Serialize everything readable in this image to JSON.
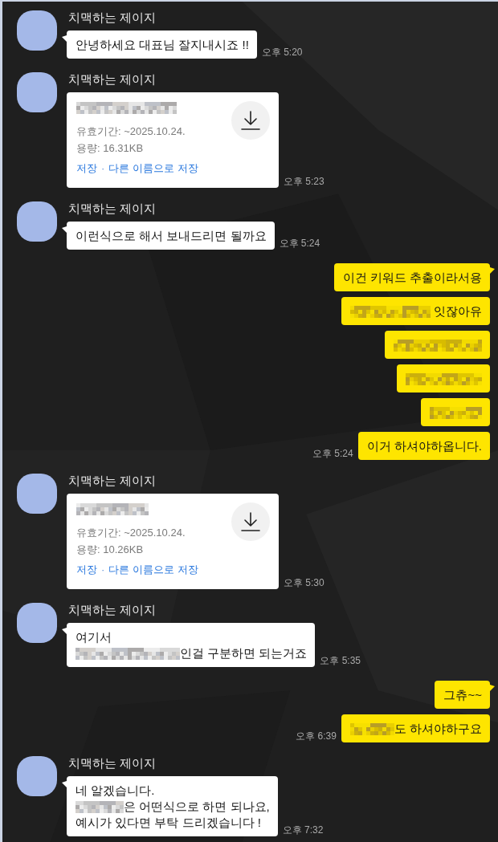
{
  "chat": [
    {
      "mine": false,
      "name": "치맥하는 제이지",
      "time": "오후 5:20",
      "messages": [
        {
          "kind": "text",
          "lines": [
            [
              {
                "kind": "text",
                "text": "안녕하세요 대표님 잘지내시죠 !!"
              }
            ]
          ]
        }
      ]
    },
    {
      "mine": false,
      "name": "치맥하는 제이지",
      "time": "오후 5:23",
      "messages": [
        {
          "kind": "file",
          "title": [
            {
              "kind": "redacted"
            }
          ],
          "expiry": "유효기간: ~2025.10.24.",
          "capacity": "용량: 16.31KB",
          "actions": [
            "저장",
            "다른 이름으로 저장"
          ],
          "separator": "·"
        }
      ]
    },
    {
      "mine": false,
      "name": "치맥하는 제이지",
      "time": "오후 5:24",
      "messages": [
        {
          "kind": "text",
          "lines": [
            [
              {
                "kind": "text",
                "text": "이런식으로 해서 보내드리면 될까요"
              }
            ]
          ]
        }
      ]
    },
    {
      "mine": true,
      "time": "오후 5:24",
      "messages": [
        {
          "kind": "text",
          "lines": [
            [
              {
                "kind": "text",
                "text": "이건 키워드 추출이라서용"
              }
            ]
          ]
        },
        {
          "kind": "text",
          "lines": [
            [
              {
                "kind": "redacted"
              },
              {
                "kind": "text",
                "text": " 잇잖아유"
              }
            ]
          ]
        },
        {
          "kind": "text",
          "lines": [
            [
              {
                "kind": "redacted"
              }
            ]
          ]
        },
        {
          "kind": "text",
          "lines": [
            [
              {
                "kind": "redacted"
              }
            ]
          ]
        },
        {
          "kind": "text",
          "lines": [
            [
              {
                "kind": "redacted"
              }
            ]
          ]
        },
        {
          "kind": "text",
          "lines": [
            [
              {
                "kind": "text",
                "text": "이거 하셔야하옵니다."
              }
            ]
          ]
        }
      ]
    },
    {
      "mine": false,
      "name": "치맥하는 제이지",
      "time": "오후 5:30",
      "messages": [
        {
          "kind": "file",
          "title": [
            {
              "kind": "redacted"
            }
          ],
          "expiry": "유효기간: ~2025.10.24.",
          "capacity": "용량: 10.26KB",
          "actions": [
            "저장",
            "다른 이름으로 저장"
          ],
          "separator": "·"
        }
      ]
    },
    {
      "mine": false,
      "name": "치맥하는 제이지",
      "time": "오후 5:35",
      "messages": [
        {
          "kind": "text",
          "lines": [
            [
              {
                "kind": "text",
                "text": "여기서"
              }
            ],
            [
              {
                "kind": "redacted"
              },
              {
                "kind": "text",
                "text": "인걸 구분하면 되는거죠"
              }
            ]
          ]
        }
      ]
    },
    {
      "mine": true,
      "time": "오후 6:39",
      "messages": [
        {
          "kind": "text",
          "lines": [
            [
              {
                "kind": "text",
                "text": "그츄~~"
              }
            ]
          ]
        },
        {
          "kind": "text",
          "lines": [
            [
              {
                "kind": "redacted"
              },
              {
                "kind": "text",
                "text": "도 하셔야하구요"
              }
            ]
          ]
        }
      ]
    },
    {
      "mine": false,
      "name": "치맥하는 제이지",
      "time": "오후 7:32",
      "messages": [
        {
          "kind": "text",
          "lines": [
            [
              {
                "kind": "text",
                "text": "네 알겠습니다."
              }
            ],
            [
              {
                "kind": "redacted"
              },
              {
                "kind": "text",
                "text": "은 어떤식으로 하면 되나요,"
              }
            ],
            [
              {
                "kind": "text",
                "text": "예시가 있다면 부탁 드리겠습니다 !"
              }
            ]
          ]
        }
      ]
    }
  ]
}
